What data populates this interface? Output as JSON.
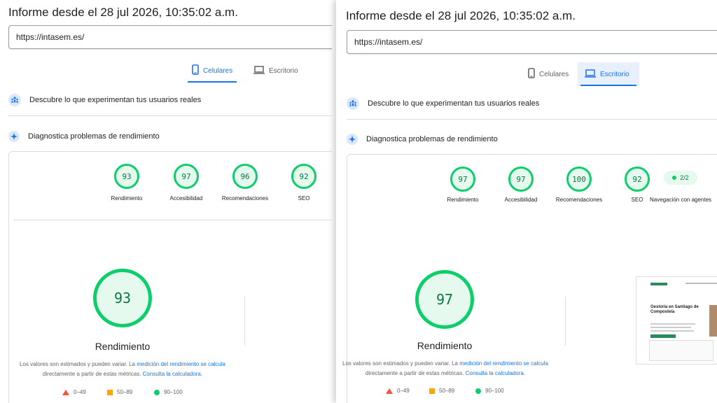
{
  "left": {
    "title": "Informe desde el 28 jul 2026, 10:35:02 a.m.",
    "url": "https://intasem.es/",
    "tabs": [
      {
        "label": "Celulares"
      },
      {
        "label": "Escritorio"
      }
    ],
    "section_ux": "Descubre lo que experimentan tus usuarios reales",
    "section_diag": "Diagnostica problemas de rendimiento",
    "scores": [
      {
        "value": "93",
        "label": "Rendimiento"
      },
      {
        "value": "97",
        "label": "Accesibilidad"
      },
      {
        "value": "96",
        "label": "Recomendaciones"
      },
      {
        "value": "92",
        "label": "SEO"
      }
    ],
    "main_score": "93",
    "main_label": "Rendimiento"
  },
  "right": {
    "title": "Informe desde el 28 jul 2026, 10:35:02 a.m.",
    "url": "https://intasem.es/",
    "tabs": [
      {
        "label": "Celulares"
      },
      {
        "label": "Escritorio"
      }
    ],
    "section_ux": "Descubre lo que experimentan tus usuarios reales",
    "section_diag": "Diagnostica problemas de rendimiento",
    "scores": [
      {
        "value": "97",
        "label": "Rendimiento"
      },
      {
        "value": "97",
        "label": "Accesibilidad"
      },
      {
        "value": "100",
        "label": "Recomendaciones"
      },
      {
        "value": "92",
        "label": "SEO"
      }
    ],
    "agent_pill": "2/2",
    "agent_label": "Navegación con agentes",
    "main_score": "97",
    "main_label": "Rendimiento",
    "thumbnail_heading": "Gestoría en Santiago de Compostela"
  },
  "note": {
    "prefix": "Los valores son estimados y pueden variar. La ",
    "link1": "medición del rendimiento se calcula",
    "middle": " directamente a partir de estas métricas. ",
    "link2": "Consulta la calculadora",
    "suffix": "."
  },
  "legend": {
    "fail": "0–49",
    "average": "50–89",
    "pass": "90–100"
  },
  "colors": {
    "pass": "#0cce6b",
    "average": "#ffa400",
    "fail": "#ff4e42",
    "accent": "#1a73e8"
  },
  "icons": [
    "phone-icon",
    "laptop-icon",
    "users-icon",
    "diagnostics-icon"
  ]
}
